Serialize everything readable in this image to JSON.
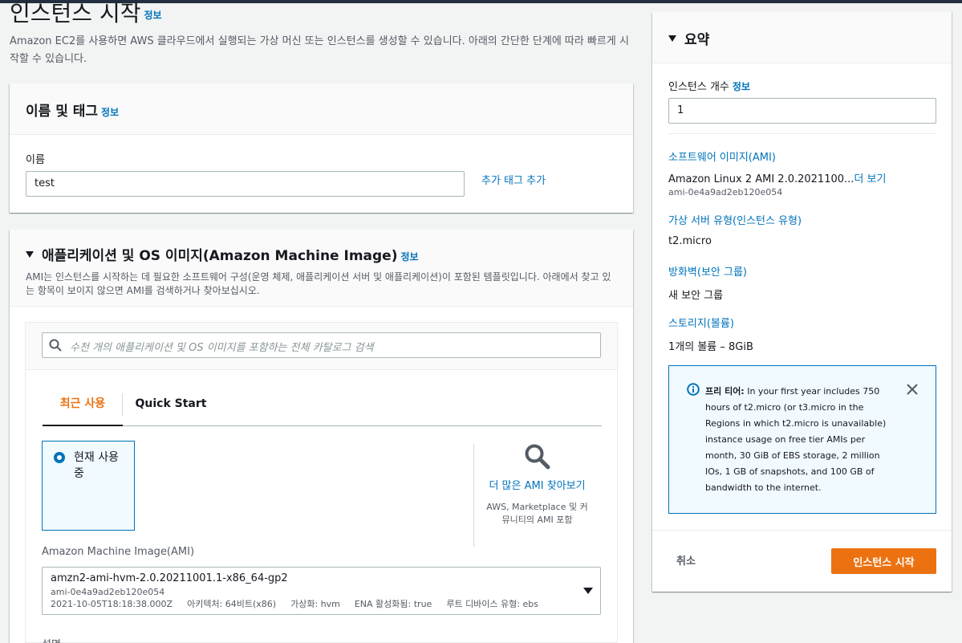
{
  "page": {
    "title": "인스턴스 시작",
    "info": "정보",
    "description": "Amazon EC2를 사용하면 AWS 클라우드에서 실행되는 가상 머신 또는 인스턴스를 생성할 수 있습니다. 아래의 간단한 단계에 따라 빠르게 시작할 수 있습니다."
  },
  "name_tags": {
    "title": "이름 및 태그",
    "info": "정보",
    "name_label": "이름",
    "name_value": "test",
    "add_tags": "추가 태그 추가"
  },
  "ami": {
    "title": "애플리케이션 및 OS 이미지(Amazon Machine Image)",
    "info": "정보",
    "description": "AMI는 인스턴스를 시작하는 데 필요한 소프트웨어 구성(운영 체제, 애플리케이션 서버 및 애플리케이션)이 포함된 템플릿입니다. 아래에서 찾고 있는 항목이 보이지 않으면 AMI를 검색하거나 찾아보십시오.",
    "search_placeholder": "수천 개의 애플리케이션 및 OS 이미지를 포함하는 전체 카탈로그 검색",
    "tabs": [
      {
        "label": "최근 사용",
        "active": true
      },
      {
        "label": "Quick Start",
        "active": false
      }
    ],
    "current_card": "현재 사용 중",
    "more_title": "더 많은 AMI 찾아보기",
    "more_sub": "AWS, Marketplace 및 커뮤니티의 AMI 포함",
    "select_label": "Amazon Machine Image(AMI)",
    "selected": {
      "name": "amzn2-ami-hvm-2.0.20211001.1-x86_64-gp2",
      "id": "ami-0e4a9ad2eb120e054",
      "date": "2021-10-05T18:18:38.000Z",
      "arch": "아키텍처: 64비트(x86)",
      "virt": "가상화: hvm",
      "ena": "ENA 활성화됨: true",
      "root": "루트 디바이스 유형: ebs"
    },
    "desc_label": "설명"
  },
  "summary": {
    "title": "요약",
    "instance_count_label": "인스턴스 개수",
    "info": "정보",
    "instance_count": "1",
    "software_image_label": "소프트웨어 이미지(AMI)",
    "software_image": "Amazon Linux 2 AMI 2.0.2021100...",
    "more_link": "더 보기",
    "software_image_id": "ami-0e4a9ad2eb120e054",
    "server_type_label": "가상 서버 유형(인스턴스 유형)",
    "server_type": "t2.micro",
    "firewall_label": "방화벽(보안 그룹)",
    "firewall": "새 보안 그룹",
    "storage_label": "스토리지(볼륨)",
    "storage": "1개의 볼륨 – 8GiB",
    "free_tier_title": "프리 티어:",
    "free_tier_text": "In your first year includes 750 hours of t2.micro (or t3.micro in the Regions in which t2.micro is unavailable) instance usage on free tier AMIs per month, 30 GiB of EBS storage, 2 million IOs, 1 GB of snapshots, and 100 GB of bandwidth to the internet.",
    "cancel": "취소",
    "launch": "인스턴스 시작"
  },
  "colors": {
    "accent": "#ec7211",
    "link": "#0073bb",
    "header_bar": "#232f3e"
  }
}
